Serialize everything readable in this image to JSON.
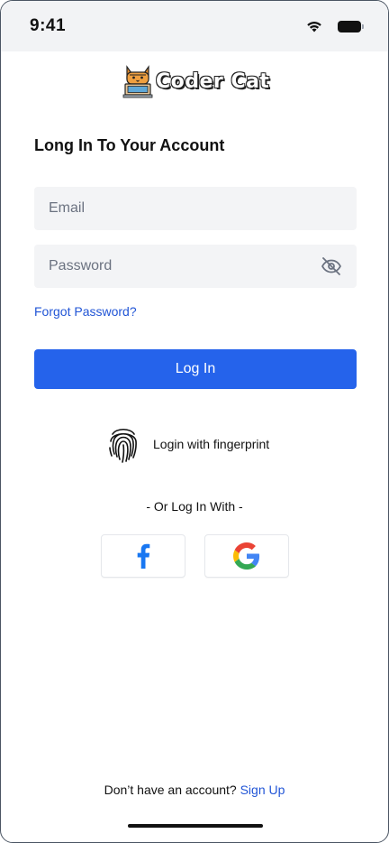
{
  "status_bar": {
    "time": "9:41",
    "icons": [
      "wifi-icon",
      "battery-icon"
    ]
  },
  "logo": {
    "text": "Coder Cat",
    "icon": "cat-mascot-icon"
  },
  "title": "Long In To Your Account",
  "form": {
    "email_placeholder": "Email",
    "email_value": "",
    "password_placeholder": "Password",
    "password_value": "",
    "password_toggle_icon": "eye-off-icon",
    "forgot_label": "Forgot Password?",
    "login_label": "Log In"
  },
  "fingerprint": {
    "label": "Login with fingerprint",
    "icon": "fingerprint-icon"
  },
  "social": {
    "divider": "- Or Log In With -",
    "buttons": [
      {
        "name": "facebook",
        "icon": "facebook-icon"
      },
      {
        "name": "google",
        "icon": "google-icon"
      }
    ]
  },
  "footer": {
    "prompt": "Don’t have an account?",
    "signup_label": "Sign Up"
  },
  "colors": {
    "primary": "#2563eb",
    "link": "#2155d6",
    "field_bg": "#f3f4f6",
    "status_bar_bg": "#f2f3f5",
    "facebook": "#1877f2"
  }
}
